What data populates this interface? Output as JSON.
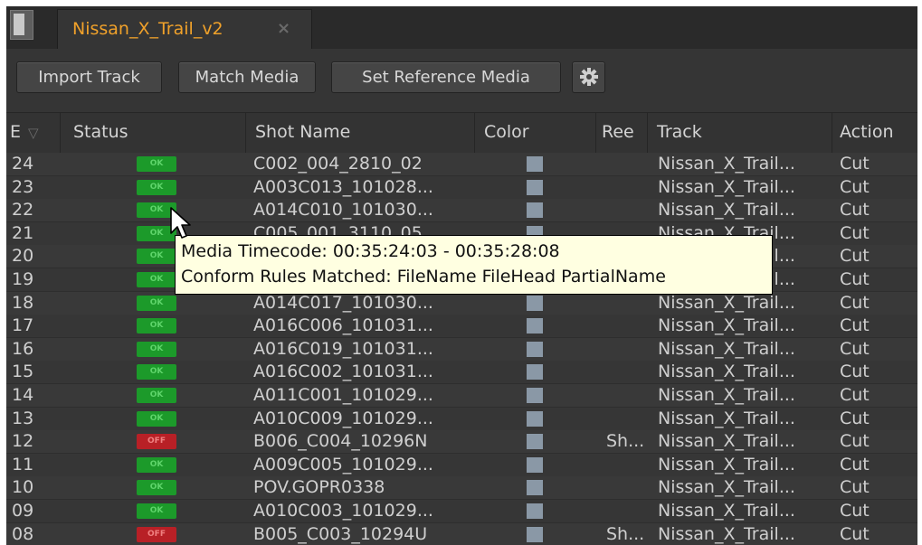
{
  "tab": {
    "title": "Nissan_X_Trail_v2",
    "close_glyph": "×"
  },
  "toolbar": {
    "import_label": "Import Track",
    "match_label": "Match Media",
    "reference_label": "Set Reference Media",
    "gear_icon": "gear-icon"
  },
  "columns": {
    "e": "E",
    "status": "Status",
    "shot_name": "Shot Name",
    "color": "Color",
    "reel": "Ree",
    "track": "Track",
    "action": "Action"
  },
  "rows": [
    {
      "e": "24",
      "status": "OK",
      "shot": "C002_004_2810_02",
      "reel": "",
      "track": "Nissan_X_Trail...",
      "action": "Cut"
    },
    {
      "e": "23",
      "status": "OK",
      "shot": "A003C013_101028...",
      "reel": "",
      "track": "Nissan_X_Trail...",
      "action": "Cut"
    },
    {
      "e": "22",
      "status": "OK",
      "shot": "A014C010_101030...",
      "reel": "",
      "track": "Nissan_X_Trail...",
      "action": "Cut"
    },
    {
      "e": "21",
      "status": "OK",
      "shot": "C005_001_3110_05",
      "reel": "",
      "track": "Nissan_X_Trail...",
      "action": "Cut"
    },
    {
      "e": "20",
      "status": "OK",
      "shot": "",
      "reel": "",
      "track": "Nissan_X_Trail...",
      "action": "Cut"
    },
    {
      "e": "19",
      "status": "OK",
      "shot": "",
      "reel": "",
      "track": "Nissan_X_Trail...",
      "action": "Cut"
    },
    {
      "e": "18",
      "status": "OK",
      "shot": "A014C017_101030...",
      "reel": "",
      "track": "Nissan_X_Trail...",
      "action": "Cut"
    },
    {
      "e": "17",
      "status": "OK",
      "shot": "A016C006_101031...",
      "reel": "",
      "track": "Nissan_X_Trail...",
      "action": "Cut"
    },
    {
      "e": "16",
      "status": "OK",
      "shot": "A016C019_101031...",
      "reel": "",
      "track": "Nissan_X_Trail...",
      "action": "Cut"
    },
    {
      "e": "15",
      "status": "OK",
      "shot": "A016C002_101031...",
      "reel": "",
      "track": "Nissan_X_Trail...",
      "action": "Cut"
    },
    {
      "e": "14",
      "status": "OK",
      "shot": "A011C001_101029...",
      "reel": "",
      "track": "Nissan_X_Trail...",
      "action": "Cut"
    },
    {
      "e": "13",
      "status": "OK",
      "shot": "A010C009_101029...",
      "reel": "",
      "track": "Nissan_X_Trail...",
      "action": "Cut"
    },
    {
      "e": "12",
      "status": "OFF",
      "shot": "B006_C004_10296N",
      "reel": "Sh...",
      "track": "Nissan_X_Trail...",
      "action": "Cut"
    },
    {
      "e": "11",
      "status": "OK",
      "shot": "A009C005_101029...",
      "reel": "",
      "track": "Nissan_X_Trail...",
      "action": "Cut"
    },
    {
      "e": "10",
      "status": "OK",
      "shot": "POV.GOPR0338",
      "reel": "",
      "track": "Nissan_X_Trail...",
      "action": "Cut"
    },
    {
      "e": "09",
      "status": "OK",
      "shot": "A010C003_101029...",
      "reel": "",
      "track": "Nissan_X_Trail...",
      "action": "Cut"
    },
    {
      "e": "08",
      "status": "OFF",
      "shot": "B005_C003_10294U",
      "reel": "Sh...",
      "track": "Nissan_X_Trail...",
      "action": "Cut"
    }
  ],
  "tooltip": {
    "line1": "Media Timecode: 00:35:24:03 - 00:35:28:08",
    "line2": "Conform Rules Matched: FileName FileHead PartialName"
  },
  "colors": {
    "accent_tab": "#f0a12a",
    "status_ok": "#1c9a2a",
    "status_off": "#b82026",
    "swatch": "#8a98a6"
  }
}
